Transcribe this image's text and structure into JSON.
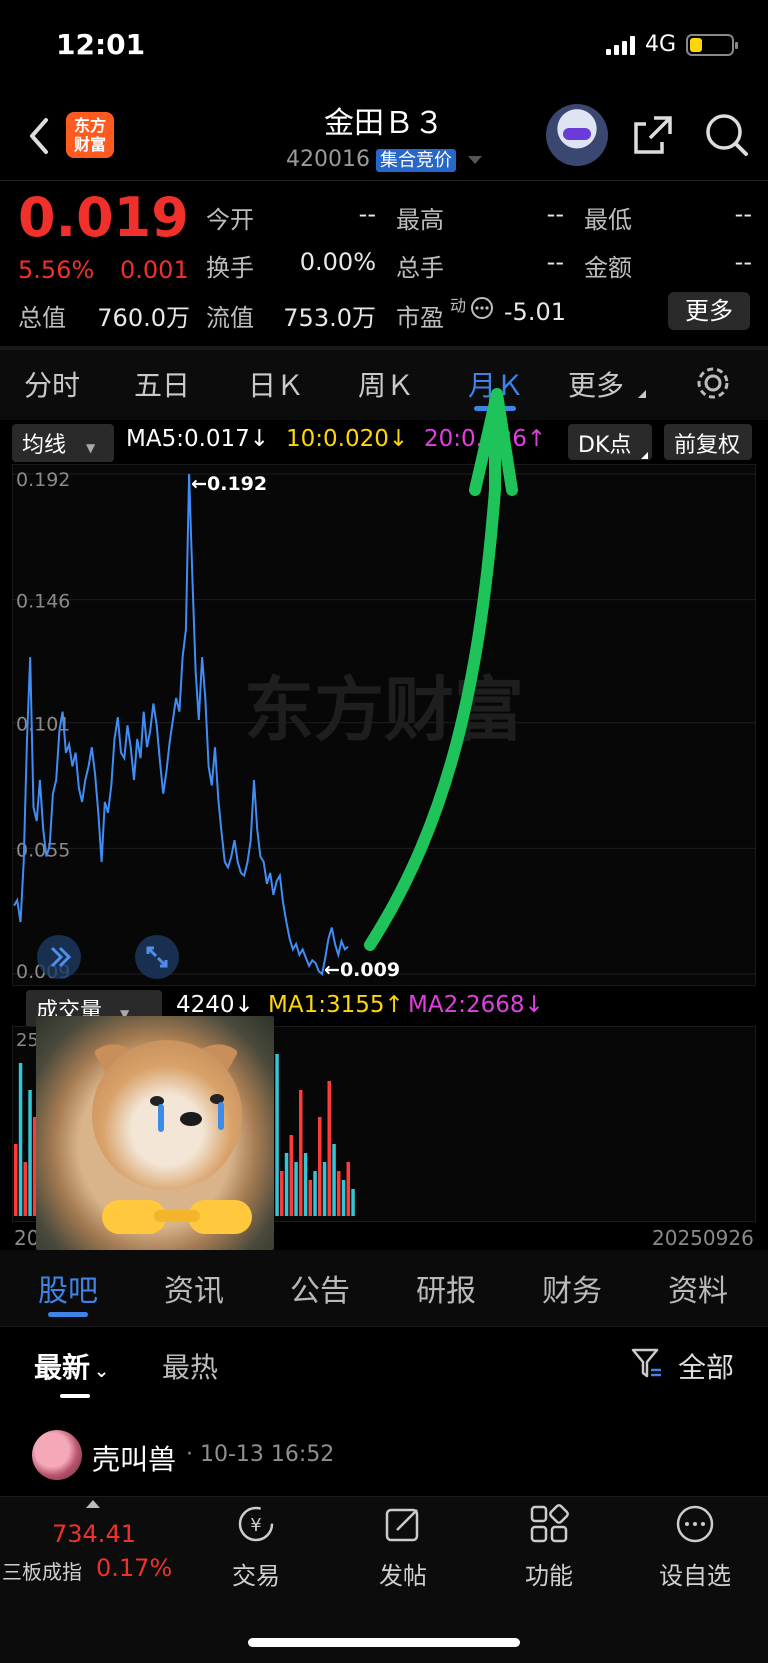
{
  "status": {
    "time": "12:01",
    "network": "4G"
  },
  "header": {
    "logo_text_line1": "东方",
    "logo_text_line2": "财富",
    "title": "金田Ｂ３",
    "code": "420016",
    "tag": "集合竞价"
  },
  "quote": {
    "price": "0.019",
    "change_pct": "5.56%",
    "change": "0.001",
    "fields": [
      {
        "label": "今开",
        "value": "--"
      },
      {
        "label": "最高",
        "value": "--"
      },
      {
        "label": "最低",
        "value": "--"
      },
      {
        "label": "换手",
        "value": "0.00%"
      },
      {
        "label": "总手",
        "value": "--"
      },
      {
        "label": "金额",
        "value": "--"
      },
      {
        "label": "总值",
        "value": "760.0万"
      },
      {
        "label": "流值",
        "value": "753.0万"
      },
      {
        "label": "市盈",
        "value": "-5.01"
      }
    ],
    "pe_superscript": "动",
    "more_label": "更多"
  },
  "kline_tabs": [
    "分时",
    "五日",
    "日Ｋ",
    "周Ｋ",
    "月Ｋ",
    "更多"
  ],
  "ma": {
    "selector": "均线",
    "ma5": "MA5:0.017↓",
    "ma10": "10:0.020↓",
    "ma20": "20:0.026↑",
    "dk": "DK点",
    "fq": "前复权"
  },
  "chart_data": {
    "type": "line",
    "y_ticks": [
      "0.192",
      "0.146",
      "0.101",
      "0.055",
      "0.009"
    ],
    "ylim": [
      0.009,
      0.192
    ],
    "max_label": "←0.192",
    "min_label": "←0.009",
    "watermark": "东方财富",
    "values": [
      0.034,
      0.036,
      0.028,
      0.05,
      0.095,
      0.125,
      0.07,
      0.065,
      0.08,
      0.062,
      0.052,
      0.056,
      0.075,
      0.08,
      0.098,
      0.105,
      0.09,
      0.093,
      0.085,
      0.09,
      0.077,
      0.072,
      0.08,
      0.085,
      0.092,
      0.082,
      0.068,
      0.05,
      0.072,
      0.068,
      0.078,
      0.095,
      0.103,
      0.09,
      0.088,
      0.1,
      0.092,
      0.08,
      0.095,
      0.088,
      0.105,
      0.092,
      0.098,
      0.108,
      0.1,
      0.087,
      0.075,
      0.083,
      0.094,
      0.102,
      0.11,
      0.105,
      0.125,
      0.135,
      0.192,
      0.155,
      0.12,
      0.102,
      0.125,
      0.11,
      0.085,
      0.078,
      0.092,
      0.073,
      0.061,
      0.05,
      0.048,
      0.052,
      0.058,
      0.05,
      0.046,
      0.045,
      0.05,
      0.058,
      0.08,
      0.062,
      0.052,
      0.05,
      0.042,
      0.046,
      0.038,
      0.043,
      0.045,
      0.035,
      0.028,
      0.022,
      0.018,
      0.02,
      0.016,
      0.018,
      0.015,
      0.012,
      0.014,
      0.013,
      0.01,
      0.009,
      0.015,
      0.022,
      0.026,
      0.02,
      0.016,
      0.021,
      0.018,
      0.019
    ]
  },
  "volume": {
    "selector": "成交量",
    "vol": "4240↓",
    "ma1": "MA1:3155↑",
    "ma2": "MA2:2668↓",
    "y_top": "25",
    "x_left": "20",
    "x_right": "20250926",
    "bars": [
      0.4,
      0.85,
      0.3,
      0.7,
      0.55,
      0.25,
      0.45,
      0.35,
      0.6,
      0.2,
      0.5,
      0.75,
      0.3,
      0.15,
      0.55,
      0.4,
      0.65,
      0.25,
      0.35,
      0.5,
      0.3,
      0.45,
      0.2,
      0.6,
      0.4,
      0.3,
      0.55,
      0.7,
      0.35,
      0.5,
      0.25,
      0.45,
      0.3,
      0.4,
      0.2,
      0.35,
      0.5,
      0.3,
      0.6,
      0.45,
      0.3,
      0.25,
      0.4,
      0.2,
      0.45,
      0.55,
      0.3,
      0.75,
      0.5,
      0.35,
      0.25,
      0.2,
      0.15,
      0.7,
      0.4,
      0.9,
      0.25,
      0.35,
      0.45,
      0.3,
      0.7,
      0.35,
      0.2,
      0.25,
      0.55,
      0.3,
      0.75,
      0.4,
      0.25,
      0.2,
      0.3,
      0.15
    ],
    "colors": [
      "#ff3a3a",
      "#33c7d6"
    ]
  },
  "sections": [
    "股吧",
    "资讯",
    "公告",
    "研报",
    "财务",
    "资料"
  ],
  "feed": {
    "sort_latest": "最新",
    "sort_hot": "最热",
    "filter": "全部",
    "post_user": "壳叫兽",
    "post_time": "· 10-13 16:52"
  },
  "bottom": {
    "index_value": "734.41",
    "index_name": "三板成指",
    "index_pct": "0.17%",
    "nav": [
      "交易",
      "发帖",
      "功能",
      "设自选"
    ]
  },
  "colors": {
    "up": "#f0312b",
    "accent": "#3f83e6",
    "ma10": "#ffd60a",
    "ma20": "#e040e0",
    "line": "#3f8df5",
    "arrow": "#1ec45a"
  }
}
